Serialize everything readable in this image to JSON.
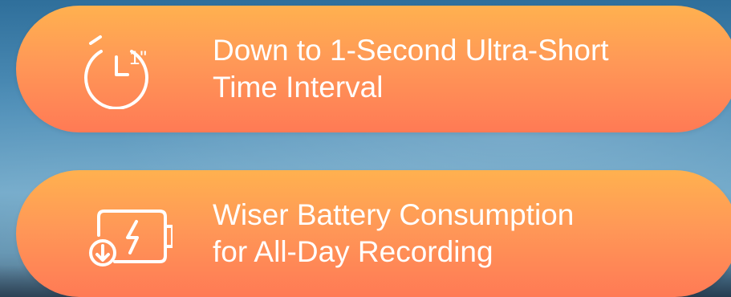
{
  "features": [
    {
      "icon": "timer-icon",
      "icon_label": "1\"",
      "line1": "Down to 1-Second Ultra-Short",
      "line2": "Time Interval"
    },
    {
      "icon": "battery-charge-icon",
      "line1": "Wiser Battery Consumption",
      "line2": "for All-Day Recording"
    }
  ],
  "colors": {
    "pill_top": "#ffb14f",
    "pill_bottom": "#ff7a55",
    "text": "#ffffff"
  }
}
